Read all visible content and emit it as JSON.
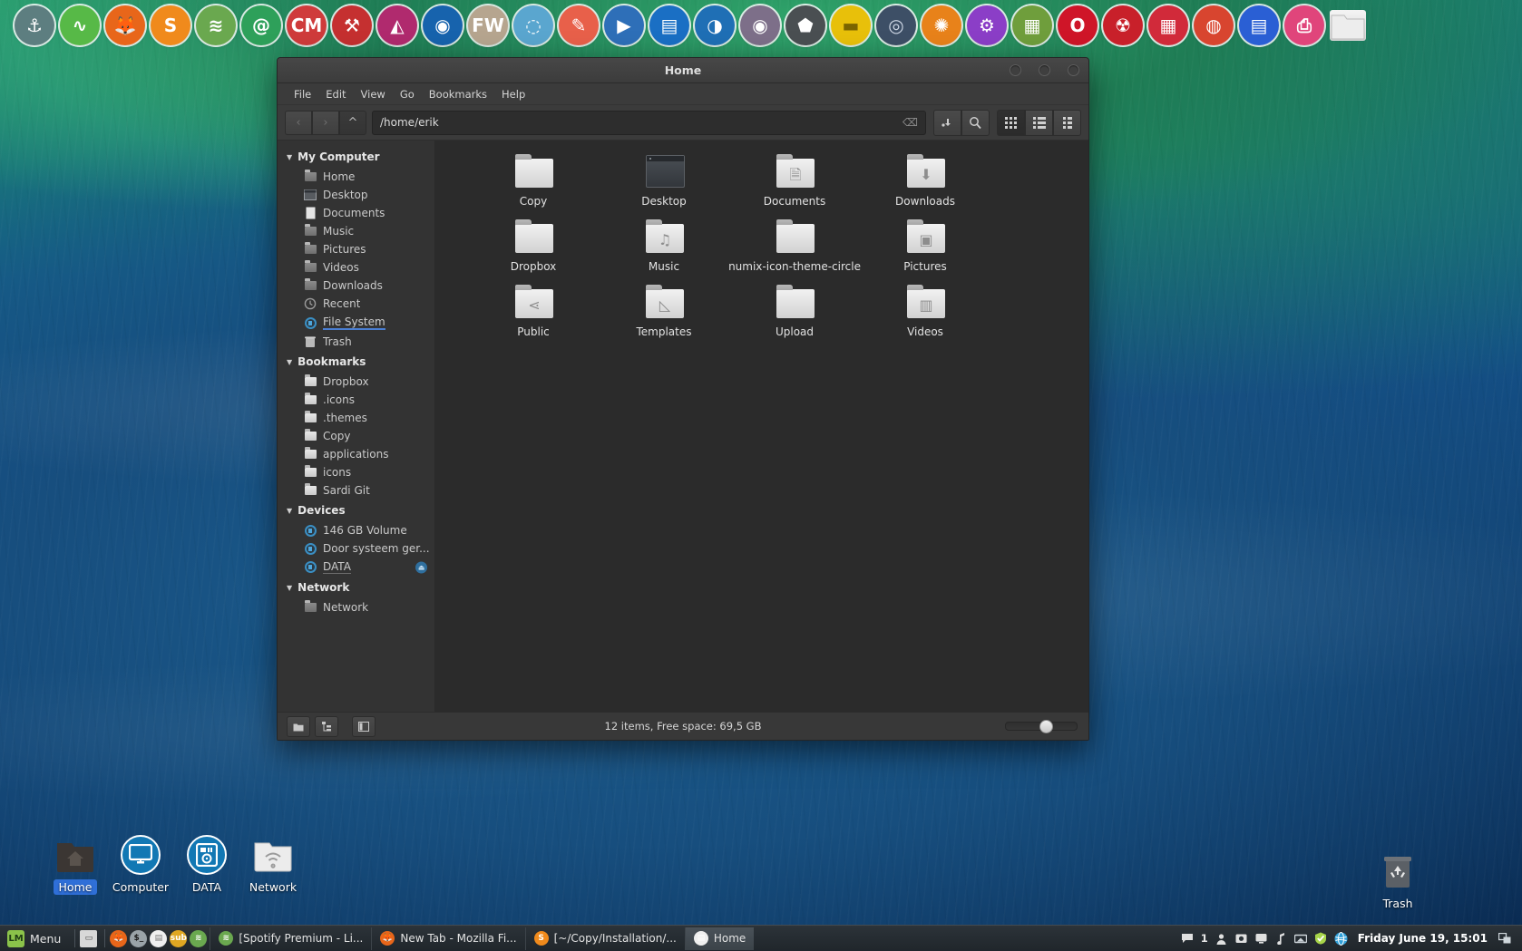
{
  "dock": {
    "items": [
      {
        "name": "plank-anchor-icon",
        "glyph": "⚓",
        "bg": "#5d7e80",
        "fg": "#ffffff"
      },
      {
        "name": "system-monitor-icon",
        "glyph": "∿",
        "bg": "#57b947",
        "fg": "#ffffff"
      },
      {
        "name": "firefox-icon",
        "glyph": "🦊",
        "bg": "#e8661a",
        "fg": "#ffffff"
      },
      {
        "name": "sublime-text-icon",
        "glyph": "S",
        "bg": "#f08a1c",
        "fg": "#ffffff"
      },
      {
        "name": "spotify-icon",
        "glyph": "≋",
        "bg": "#6aa84f",
        "fg": "#ffffff"
      },
      {
        "name": "mail-icon",
        "glyph": "@",
        "bg": "#2ea05a",
        "fg": "#ffffff"
      },
      {
        "name": "clementine-icon",
        "glyph": "CM",
        "bg": "#cf3b3b",
        "fg": "#ffffff"
      },
      {
        "name": "tools-icon",
        "glyph": "⚒",
        "bg": "#c53030",
        "fg": "#ffffff"
      },
      {
        "name": "inkscape-icon",
        "glyph": "◭",
        "bg": "#b02a6e",
        "fg": "#ffffff"
      },
      {
        "name": "audacious-icon",
        "glyph": "◉",
        "bg": "#1763ad",
        "fg": "#ffffff"
      },
      {
        "name": "filewalker-icon",
        "glyph": "FW",
        "bg": "#b6a58f",
        "fg": "#ffffff"
      },
      {
        "name": "brasero-icon",
        "glyph": "◌",
        "bg": "#5aa6cf",
        "fg": "#ffffff"
      },
      {
        "name": "editor-pencil-icon",
        "glyph": "✎",
        "bg": "#e8604a",
        "fg": "#ffffff"
      },
      {
        "name": "video-player-icon",
        "glyph": "▶",
        "bg": "#2e6fb8",
        "fg": "#ffffff"
      },
      {
        "name": "image-viewer-icon",
        "glyph": "▤",
        "bg": "#1a6fc4",
        "fg": "#ffffff"
      },
      {
        "name": "deluge-icon",
        "glyph": "◑",
        "bg": "#1f6fb5",
        "fg": "#ffffff"
      },
      {
        "name": "record-icon",
        "glyph": "◉",
        "bg": "#7d6f89",
        "fg": "#ffffff"
      },
      {
        "name": "shield-icon",
        "glyph": "⬟",
        "bg": "#4a4f52",
        "fg": "#ffffff"
      },
      {
        "name": "ruler-icon",
        "glyph": "▬",
        "bg": "#e8c00a",
        "fg": "#7a6400"
      },
      {
        "name": "disc-icon",
        "glyph": "◎",
        "bg": "#3d4f66",
        "fg": "#cfd8e6"
      },
      {
        "name": "gimp-icon",
        "glyph": "✺",
        "bg": "#e8821a",
        "fg": "#ffffff"
      },
      {
        "name": "gparted-icon",
        "glyph": "⚙",
        "bg": "#8b3ec7",
        "fg": "#ffffff"
      },
      {
        "name": "hardware-icon",
        "glyph": "▦",
        "bg": "#6f9e3c",
        "fg": "#ffffff"
      },
      {
        "name": "opera-icon",
        "glyph": "O",
        "bg": "#cf1528",
        "fg": "#ffffff"
      },
      {
        "name": "radioactive-icon",
        "glyph": "☢",
        "bg": "#c8202a",
        "fg": "#ffffff"
      },
      {
        "name": "calculator-icon",
        "glyph": "▦",
        "bg": "#d12a3a",
        "fg": "#ffffff"
      },
      {
        "name": "chrome-icon",
        "glyph": "◍",
        "bg": "#d8452f",
        "fg": "#ffffff"
      },
      {
        "name": "libreoffice-writer-icon",
        "glyph": "▤",
        "bg": "#2a5fd4",
        "fg": "#ffffff"
      },
      {
        "name": "printer-icon",
        "glyph": "⎙",
        "bg": "#e0457b",
        "fg": "#ffffff"
      },
      {
        "name": "folder-icon",
        "glyph": "",
        "bg": "#efefef",
        "fg": "#888888"
      }
    ]
  },
  "window": {
    "title": "Home",
    "menubar": [
      "File",
      "Edit",
      "View",
      "Go",
      "Bookmarks",
      "Help"
    ],
    "toolbar": {
      "back": "‹",
      "forward": "›",
      "up": "^",
      "path_value": "/home/erik",
      "path_placeholder": "/home/erik",
      "clear": "⌫",
      "open_terminal": "↵",
      "search": "⌕",
      "view_icons": "grid",
      "view_list": "list",
      "view_compact": "compact"
    },
    "sidebar": [
      {
        "group": "My Computer",
        "items": [
          {
            "label": "Home",
            "icon": "home-folder-icon"
          },
          {
            "label": "Desktop",
            "icon": "desktop-icon"
          },
          {
            "label": "Documents",
            "icon": "documents-icon"
          },
          {
            "label": "Music",
            "icon": "music-folder-icon"
          },
          {
            "label": "Pictures",
            "icon": "pictures-folder-icon"
          },
          {
            "label": "Videos",
            "icon": "videos-folder-icon"
          },
          {
            "label": "Downloads",
            "icon": "downloads-folder-icon"
          },
          {
            "label": "Recent",
            "icon": "recent-icon"
          },
          {
            "label": "File System",
            "icon": "disk-icon",
            "state": "selected"
          },
          {
            "label": "Trash",
            "icon": "trash-icon"
          }
        ]
      },
      {
        "group": "Bookmarks",
        "items": [
          {
            "label": "Dropbox",
            "icon": "folder-icon"
          },
          {
            "label": ".icons",
            "icon": "folder-icon"
          },
          {
            "label": ".themes",
            "icon": "folder-icon"
          },
          {
            "label": "Copy",
            "icon": "folder-icon"
          },
          {
            "label": "applications",
            "icon": "folder-icon"
          },
          {
            "label": "icons",
            "icon": "folder-icon"
          },
          {
            "label": "Sardi Git",
            "icon": "folder-icon"
          }
        ]
      },
      {
        "group": "Devices",
        "items": [
          {
            "label": "146 GB Volume",
            "icon": "disk-icon"
          },
          {
            "label": "Door systeem ger...",
            "icon": "disk-icon"
          },
          {
            "label": "DATA",
            "icon": "disk-icon",
            "state": "underline",
            "eject": true
          }
        ]
      },
      {
        "group": "Network",
        "items": [
          {
            "label": "Network",
            "icon": "network-folder-icon"
          }
        ]
      }
    ],
    "files": [
      {
        "label": "Copy",
        "icon": "folder-plain-icon",
        "glyph": ""
      },
      {
        "label": "Desktop",
        "icon": "folder-desktop-icon",
        "glyph": ""
      },
      {
        "label": "Documents",
        "icon": "folder-documents-icon",
        "glyph": "🗎"
      },
      {
        "label": "Downloads",
        "icon": "folder-downloads-icon",
        "glyph": "⬇"
      },
      {
        "label": "Dropbox",
        "icon": "folder-plain-icon",
        "glyph": ""
      },
      {
        "label": "Music",
        "icon": "folder-music-icon",
        "glyph": "♫"
      },
      {
        "label": "numix-icon-theme-circle",
        "icon": "folder-plain-icon",
        "glyph": ""
      },
      {
        "label": "Pictures",
        "icon": "folder-pictures-icon",
        "glyph": "▣"
      },
      {
        "label": "Public",
        "icon": "folder-public-icon",
        "glyph": "⋖"
      },
      {
        "label": "Templates",
        "icon": "folder-templates-icon",
        "glyph": "◺"
      },
      {
        "label": "Upload",
        "icon": "folder-plain-icon",
        "glyph": ""
      },
      {
        "label": "Videos",
        "icon": "folder-videos-icon",
        "glyph": "▥"
      }
    ],
    "statusbar": {
      "text": "12 items, Free space: 69,5 GB",
      "btn_folder": "▤",
      "btn_tree": "⊞",
      "btn_pane": "◧",
      "zoom": 55
    }
  },
  "desktop_icons": [
    {
      "label": "Home",
      "icon": "home-folder-icon",
      "selected": true
    },
    {
      "label": "Computer",
      "icon": "computer-icon",
      "selected": false
    },
    {
      "label": "DATA",
      "icon": "disk-drive-icon",
      "selected": false
    },
    {
      "label": "Network",
      "icon": "network-folder-icon",
      "selected": false
    }
  ],
  "trash_icon": {
    "label": "Trash",
    "icon": "trash-icon"
  },
  "taskbar": {
    "menu_label": "Menu",
    "launchers": [
      {
        "name": "show-desktop-icon",
        "glyph": "▭",
        "bg": "#d8d8d8",
        "fg": "#444444"
      },
      {
        "name": "firefox-launcher-icon",
        "glyph": "🦊",
        "bg": "#e8661a",
        "fg": "#ffffff"
      },
      {
        "name": "terminal-launcher-icon",
        "glyph": "$_",
        "bg": "#9aa3a8",
        "fg": "#1c1c1c"
      },
      {
        "name": "files-launcher-icon",
        "glyph": "▤",
        "bg": "#efefef",
        "fg": "#777777"
      },
      {
        "name": "subtitles-launcher-icon",
        "glyph": "sub",
        "bg": "#e0a722",
        "fg": "#ffffff"
      },
      {
        "name": "spotify-launcher-icon",
        "glyph": "≋",
        "bg": "#6aa84f",
        "fg": "#ffffff"
      }
    ],
    "tasks": [
      {
        "label": "[Spotify Premium - Li...",
        "icon": "spotify-icon",
        "bg": "#6aa84f",
        "glyph": "≋",
        "active": false
      },
      {
        "label": "New Tab - Mozilla Fi...",
        "icon": "firefox-icon",
        "bg": "#e8661a",
        "glyph": "🦊",
        "active": false
      },
      {
        "label": "[~/Copy/Installation/...",
        "icon": "sublime-text-icon",
        "bg": "#f08a1c",
        "glyph": "S",
        "active": false
      },
      {
        "label": "Home",
        "icon": "file-manager-icon",
        "bg": "#efefef",
        "glyph": "▤",
        "active": true
      }
    ],
    "tray": {
      "message_count": "1",
      "icons": [
        {
          "name": "messages-icon",
          "glyph": "▰"
        },
        {
          "name": "user-icon",
          "glyph": "👤"
        },
        {
          "name": "screenshot-icon",
          "glyph": "▣"
        },
        {
          "name": "display-icon",
          "glyph": "▭"
        },
        {
          "name": "sound-icon",
          "glyph": "♪"
        },
        {
          "name": "network-tray-icon",
          "glyph": "▰"
        },
        {
          "name": "update-shield-icon",
          "glyph": "✔"
        },
        {
          "name": "globe-icon",
          "glyph": "◉"
        }
      ],
      "clock": "Friday June 19, 15:01",
      "workspace_icon": "▥"
    }
  }
}
